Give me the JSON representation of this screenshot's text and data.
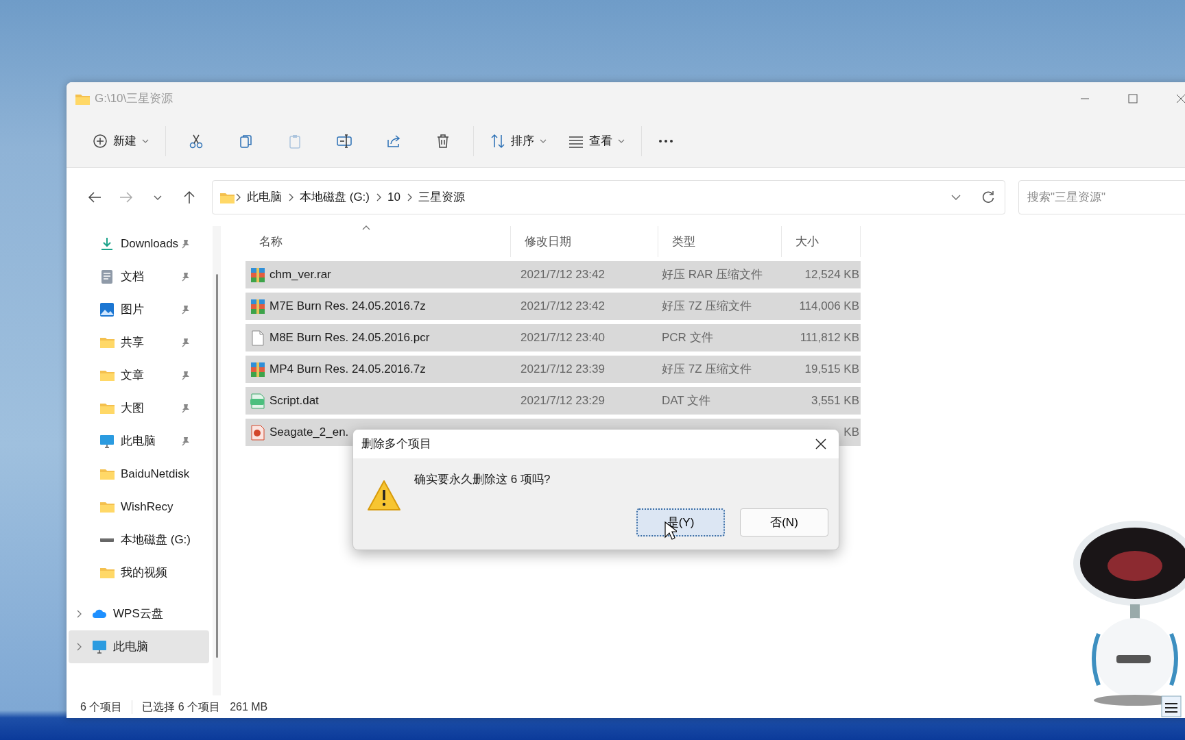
{
  "window": {
    "title": "G:\\10\\三星资源"
  },
  "toolbar": [
    {
      "kind": "new",
      "label": "新建",
      "disabled": false
    },
    {
      "kind": "cut",
      "disabled": false
    },
    {
      "kind": "copy",
      "disabled": false
    },
    {
      "kind": "paste",
      "disabled": true
    },
    {
      "kind": "rename",
      "disabled": false
    },
    {
      "kind": "share",
      "disabled": false
    },
    {
      "kind": "delete",
      "disabled": false
    },
    {
      "kind": "sort",
      "label": "排序",
      "disabled": false
    },
    {
      "kind": "view",
      "label": "查看",
      "disabled": false
    },
    {
      "kind": "more",
      "disabled": false
    }
  ],
  "address": {
    "crumbs": [
      "此电脑",
      "本地磁盘 (G:)",
      "10",
      "三星资源"
    ]
  },
  "search": {
    "placeholder": "搜索\"三星资源\""
  },
  "sidebar": {
    "items": [
      {
        "label": "Downloads",
        "kind": "downloads",
        "pinned": true,
        "selected": false
      },
      {
        "label": "文档",
        "kind": "document",
        "pinned": true,
        "selected": false
      },
      {
        "label": "图片",
        "kind": "pictures",
        "pinned": true,
        "selected": false
      },
      {
        "label": "共享",
        "kind": "folder",
        "pinned": true,
        "selected": false
      },
      {
        "label": "文章",
        "kind": "folder",
        "pinned": true,
        "selected": false
      },
      {
        "label": "大图",
        "kind": "folder",
        "pinned": true,
        "selected": false
      },
      {
        "label": "此电脑",
        "kind": "pc",
        "pinned": true,
        "selected": false
      },
      {
        "label": "BaiduNetdisk",
        "kind": "folder",
        "pinned": false,
        "selected": false
      },
      {
        "label": "WishRecy",
        "kind": "folder",
        "pinned": false,
        "selected": false
      },
      {
        "label": "本地磁盘 (G:)",
        "kind": "drive",
        "pinned": false,
        "selected": false
      },
      {
        "label": "我的视频",
        "kind": "folder",
        "pinned": false,
        "selected": false
      }
    ],
    "tree": [
      {
        "label": "WPS云盘",
        "kind": "cloud",
        "expanded": false,
        "selected": false
      },
      {
        "label": "此电脑",
        "kind": "pc",
        "expanded": false,
        "selected": true
      }
    ]
  },
  "table": {
    "columns": [
      {
        "label": "名称",
        "sorted": true
      },
      {
        "label": "修改日期",
        "sorted": false
      },
      {
        "label": "类型",
        "sorted": false
      },
      {
        "label": "大小",
        "sorted": false
      }
    ],
    "rows": [
      {
        "name": "chm_ver.rar",
        "date": "2021/7/12 23:42",
        "type": "好压 RAR 压缩文件",
        "size": "12,524 KB",
        "kind": "archive",
        "selected": true
      },
      {
        "name": "M7E Burn Res. 24.05.2016.7z",
        "date": "2021/7/12 23:42",
        "type": "好压 7Z 压缩文件",
        "size": "114,006 KB",
        "kind": "archive",
        "selected": true
      },
      {
        "name": "M8E Burn Res. 24.05.2016.pcr",
        "date": "2021/7/12 23:40",
        "type": "PCR 文件",
        "size": "111,812 KB",
        "kind": "blank",
        "selected": true
      },
      {
        "name": "MP4 Burn Res. 24.05.2016.7z",
        "date": "2021/7/12 23:39",
        "type": "好压 7Z 压缩文件",
        "size": "19,515 KB",
        "kind": "archive",
        "selected": true
      },
      {
        "name": "Script.dat",
        "date": "2021/7/12 23:29",
        "type": "DAT 文件",
        "size": "3,551 KB",
        "kind": "video",
        "selected": true
      },
      {
        "name": "Seagate_2_en.",
        "size": "KB",
        "kind": "red",
        "selected": true
      }
    ]
  },
  "dialog": {
    "title": "删除多个项目",
    "message": "确实要永久删除这 6 项吗?",
    "buttons": [
      {
        "label": "是(Y)",
        "selected": true
      },
      {
        "label": "否(N)",
        "selected": false
      }
    ]
  },
  "status_bar": {
    "count": "6 个项目",
    "selection": "已选择 6 个项目",
    "size": "261 MB"
  }
}
